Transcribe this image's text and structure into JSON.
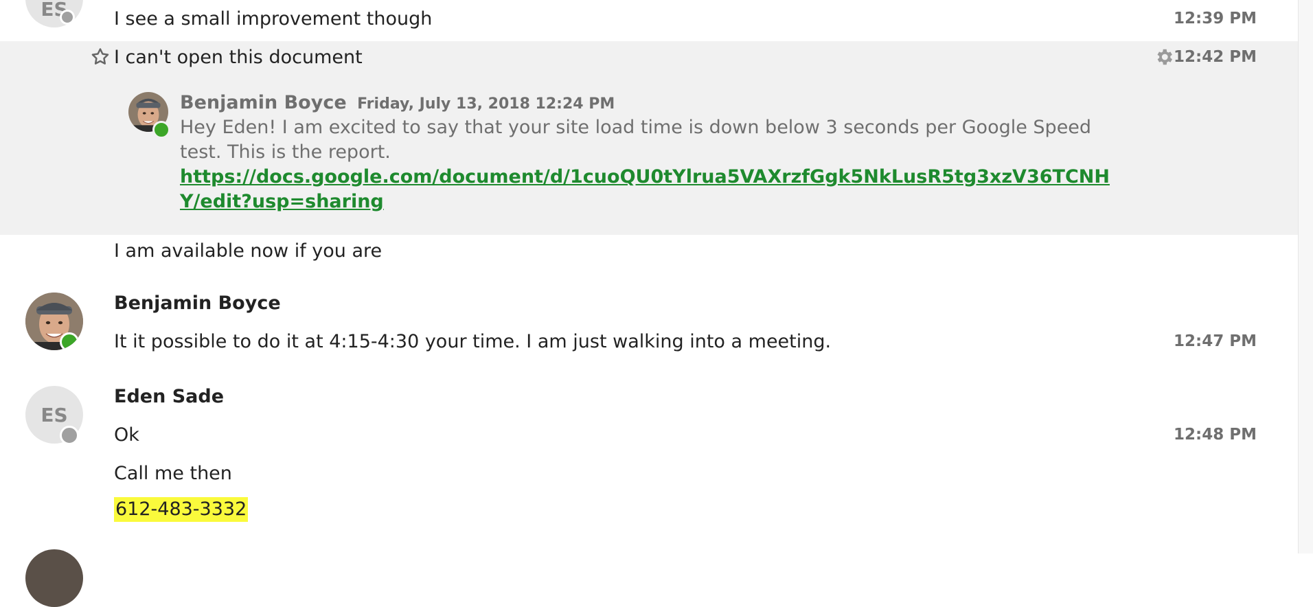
{
  "messages": {
    "m1": {
      "text": "I see a small improvement though",
      "time": "12:39 PM"
    },
    "m2": {
      "text": "I can't open this document",
      "time": "12:42 PM",
      "quote": {
        "sender": "Benjamin Boyce",
        "date": "Friday, July 13, 2018 12:24 PM",
        "body": "Hey Eden! I am excited to say that your site load time is down below 3 seconds per Google Speed test. This is the report.",
        "link": "https://docs.google.com/document/d/1cuoQU0tYlrua5VAXrzfGgk5NkLusR5tg3xzV36TCNHY/edit?usp=sharing"
      }
    },
    "m3": {
      "text": "I am available now if you are"
    },
    "m4": {
      "sender": "Benjamin Boyce",
      "text": "It it possible to do it at 4:15-4:30 your time. I am just walking into a meeting.",
      "time": "12:47 PM"
    },
    "m5": {
      "sender": "Eden Sade",
      "initials": "ES",
      "text": "Ok",
      "time": "12:48 PM"
    },
    "m6": {
      "text": "Call me then"
    },
    "m7": {
      "text": "612-483-3332"
    }
  },
  "top_avatar": {
    "initials": "ES"
  },
  "icons": {
    "star": "star-icon",
    "gear": "gear-icon"
  },
  "colors": {
    "link": "#1e8a2e",
    "online": "#3ca628",
    "away": "#a0a0a0",
    "highlight_row": "#f1f1f1",
    "phone_highlight": "#fafa3c"
  }
}
